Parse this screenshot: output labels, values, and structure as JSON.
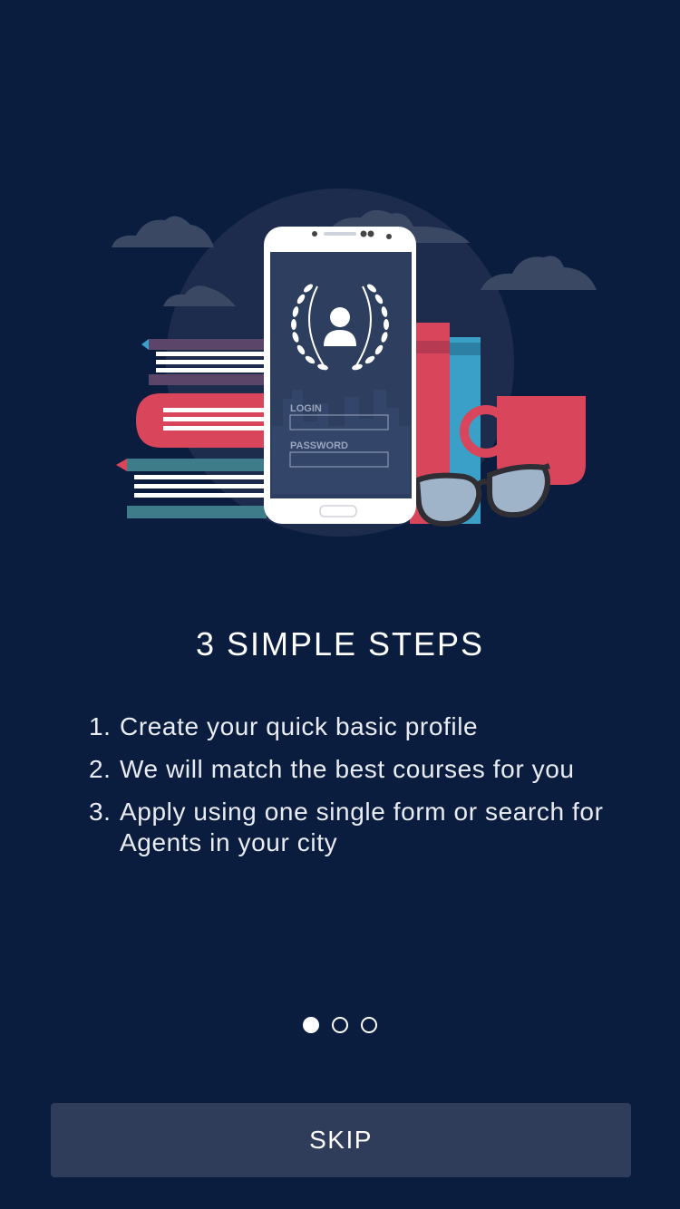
{
  "illustration": {
    "login_label": "LOGIN",
    "password_label": "PASSWORD"
  },
  "title": "3 SIMPLE STEPS",
  "steps": [
    {
      "num": "1.",
      "text": "Create your quick basic profile"
    },
    {
      "num": "2.",
      "text": "We will match the best courses for you"
    },
    {
      "num": "3.",
      "text": "Apply using one single form or search for Agents in your city"
    }
  ],
  "pagination": {
    "total": 3,
    "active": 1
  },
  "skip_label": "SKIP",
  "colors": {
    "background": "#0b1d3f",
    "button": "#2f3d5a",
    "accent_red": "#d9465c",
    "accent_teal": "#3aa0c8"
  }
}
